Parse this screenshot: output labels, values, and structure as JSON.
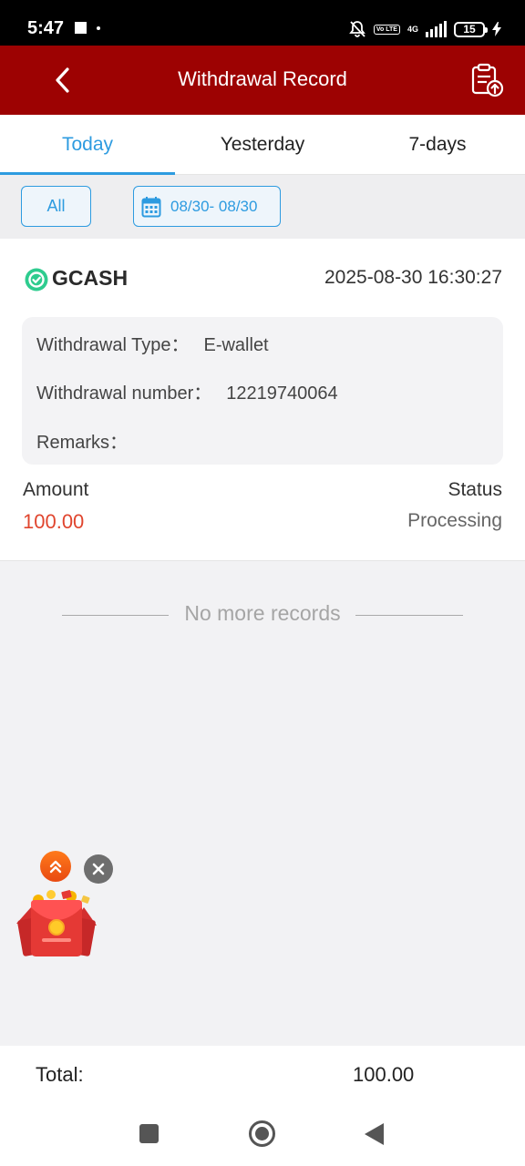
{
  "status_bar": {
    "time": "5:47",
    "network": "4G",
    "volte_label": "Vo LTE",
    "battery": "15"
  },
  "header": {
    "title": "Withdrawal Record",
    "background": "#9d0202"
  },
  "tabs": [
    {
      "label": "Today",
      "active": true
    },
    {
      "label": "Yesterday",
      "active": false
    },
    {
      "label": "7-days",
      "active": false
    }
  ],
  "filters": {
    "all_label": "All",
    "date_range": "08/30- 08/30"
  },
  "records": [
    {
      "method": "GCASH",
      "datetime": "2025-08-30 16:30:27",
      "type_label": "Withdrawal Type：",
      "type_value": "E-wallet",
      "number_label": "Withdrawal number：",
      "number_value": "12219740064",
      "remarks_label": "Remarks：",
      "remarks_value": "",
      "amount_label": "Amount",
      "amount_value": "100.00",
      "status_label": "Status",
      "status_value": "Processing"
    }
  ],
  "list_end_text": "No more records",
  "total": {
    "label": "Total:",
    "value": "100.00"
  },
  "colors": {
    "accent": "#2d9be0",
    "amount": "#e0452e",
    "header": "#9d0202"
  },
  "icons": {
    "back": "chevron-left-icon",
    "export": "clipboard-upload-icon",
    "calendar": "calendar-icon",
    "gcash": "gcash-logo-icon",
    "promo": "red-envelope-icon",
    "promo_up": "double-chevron-up-icon",
    "promo_close": "close-icon"
  }
}
